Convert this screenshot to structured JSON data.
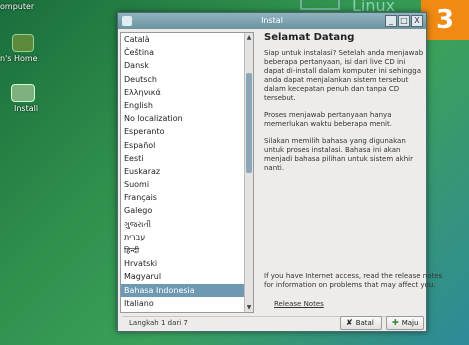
{
  "desktop": {
    "icons": [
      {
        "label": "omputer"
      },
      {
        "label": "n's Home"
      },
      {
        "label": "Install"
      }
    ],
    "watermark": "Linux",
    "badge": "3"
  },
  "window": {
    "title": "Instal",
    "controls": [
      "_",
      "□",
      "X"
    ]
  },
  "languages": {
    "items": [
      "Català",
      "Čeština",
      "Dansk",
      "Deutsch",
      "Ελληνικά",
      "English",
      "No localization",
      "Esperanto",
      "Español",
      "Eesti",
      "Euskaraz",
      "Suomi",
      "Français",
      "Galego",
      "ગુજરાતી",
      "עברית",
      "हिन्दी",
      "Hrvatski",
      "Magyarul",
      "Bahasa Indonesia",
      "Italiano"
    ],
    "selected": "Bahasa Indonesia"
  },
  "welcome": {
    "heading": "Selamat Datang",
    "para1": "Siap untuk instalasi? Setelah anda menjawab beberapa pertanyaan, isi dari live CD ini dapat di-install dalam komputer ini sehingga anda dapat menjalankan sistem tersebut dalam kecepatan penuh dan tanpa CD tersebut.",
    "para2": "Proses menjawab pertanyaan hanya memerlukan waktu beberapa menit.",
    "para3": "Silakan memilih bahasa yang digunakan untuk proses instalasi. Bahasa ini akan menjadi bahasa pilihan untuk sistem akhir nanti.",
    "internet_note": "If you have Internet access, read the release notes for information on problems that may affect you.",
    "release_notes": "Release Notes"
  },
  "footer": {
    "step": "Langkah 1 dari 7",
    "cancel_label": "Batal",
    "next_label": "Maju"
  }
}
